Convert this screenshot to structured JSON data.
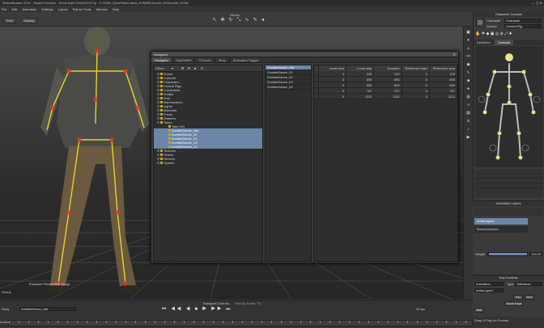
{
  "window": {
    "title": "MotionBuilder 2014 - Student Version - 64 bit build 03/04/2013 Sp - F:/GSW_WorkFiles/Latest_ZOMBIE/Zombi_03/Zombie_03.fbx"
  },
  "menu": [
    "File",
    "Edit",
    "Animation",
    "Settings",
    "Layout",
    "Python Tools",
    "Window",
    "Help"
  ],
  "toolbar": {
    "left_btn_1": "Rein",
    "left_btn_2": "Display",
    "viewer_label": "Viewer"
  },
  "viewer": {
    "camera_label": "Producer Perspective (Xray)"
  },
  "navigator": {
    "title": "Navigator",
    "tabs": [
      "Navigator",
      "Dopesheet",
      "FCurves",
      "Story",
      "Animation Trigger"
    ],
    "active_tab": "Navigator",
    "tree_filter_label": "Filters",
    "tree": [
      {
        "label": "Scene",
        "depth": 0,
        "sel": false
      },
      {
        "label": "Controls",
        "depth": 0,
        "sel": false
      },
      {
        "label": "Characters",
        "depth": 0,
        "sel": false
      },
      {
        "label": "Control Rigs",
        "depth": 0,
        "sel": false
      },
      {
        "label": "Constraints",
        "depth": 0,
        "sel": false
      },
      {
        "label": "Scripts",
        "depth": 0,
        "sel": false
      },
      {
        "label": "Sets",
        "depth": 0,
        "sel": false
      },
      {
        "label": "Namespaces",
        "depth": 0,
        "sel": false
      },
      {
        "label": "Lights",
        "depth": 0,
        "sel": false
      },
      {
        "label": "Materials",
        "depth": 0,
        "sel": false
      },
      {
        "label": "Poses",
        "depth": 0,
        "sel": false
      },
      {
        "label": "Shaders",
        "depth": 0,
        "sel": false
      },
      {
        "label": "Takes",
        "depth": 0,
        "sel": false
      },
      {
        "label": "Take 001",
        "depth": 1,
        "sel": false
      },
      {
        "label": "ZombieDance_Idle",
        "depth": 1,
        "sel": true
      },
      {
        "label": "ZombieDance_01",
        "depth": 1,
        "sel": true
      },
      {
        "label": "ZombieDance_02",
        "depth": 1,
        "sel": true
      },
      {
        "label": "ZombieDance_03",
        "depth": 1,
        "sel": true
      },
      {
        "label": "ZombieDance_04",
        "depth": 1,
        "sel": true
      },
      {
        "label": "Textures",
        "depth": 0,
        "sel": false
      },
      {
        "label": "Videos",
        "depth": 0,
        "sel": false
      },
      {
        "label": "Devices",
        "depth": 0,
        "sel": false
      },
      {
        "label": "System",
        "depth": 0,
        "sel": false
      }
    ],
    "takes": [
      {
        "label": "ZombieDance_Idle",
        "sel": true
      },
      {
        "label": "ZombieDance_01",
        "sel": false
      },
      {
        "label": "ZombieDance_02",
        "sel": false
      },
      {
        "label": "ZombieDance_03",
        "sel": false
      },
      {
        "label": "ZombieDance_04",
        "sel": false
      }
    ],
    "columns": [
      "Local start",
      "Local stop",
      "Duration",
      "Reference start",
      "Reference stop"
    ],
    "rows": [
      [
        "0",
        "120",
        "120",
        "0",
        "120"
      ],
      [
        "0",
        "893",
        "893",
        "0",
        "893"
      ],
      [
        "0",
        "593",
        "593",
        "0",
        "593"
      ],
      [
        "0",
        "767",
        "767",
        "0",
        "767"
      ],
      [
        "0",
        "1112",
        "1112",
        "0",
        "1112"
      ]
    ]
  },
  "character_controls": {
    "title": "Character Controls",
    "character_label": "Character",
    "character_value": "Character",
    "source_label": "Source",
    "source_value": "Control Rig",
    "tabs": [
      "Definition",
      "Controls"
    ],
    "active_tab": "Controls"
  },
  "animation_layers": {
    "title": "Animation Layers",
    "layers": [
      {
        "label": "AnimLayer1",
        "sel": true
      },
      {
        "label": "BaseAnimation",
        "sel": false
      }
    ],
    "weight_label": "Weight",
    "weight_value": "100.00"
  },
  "key_controls": {
    "title": "Key Controls",
    "mode_label": "Animation",
    "type_label": "Type",
    "type_value": "SetDance",
    "layer_label": "AnimLayer1",
    "buttons": [
      "Key",
      "Zero",
      "Move Keys",
      "Bak"
    ]
  },
  "transport": {
    "title": "Transport Controls",
    "subtitle": "Velocity Break: T6",
    "take_label": "Story",
    "take_value": "ZombieDance_Idle",
    "snap_label": "Snap & Play on Frames",
    "fps_label": "30 fps"
  },
  "status": {
    "text": "Ready"
  },
  "colors": {
    "accent_selection": "#6b86a8",
    "skeleton_bones": "#e8d22a",
    "joint_red": "#d8332f"
  }
}
